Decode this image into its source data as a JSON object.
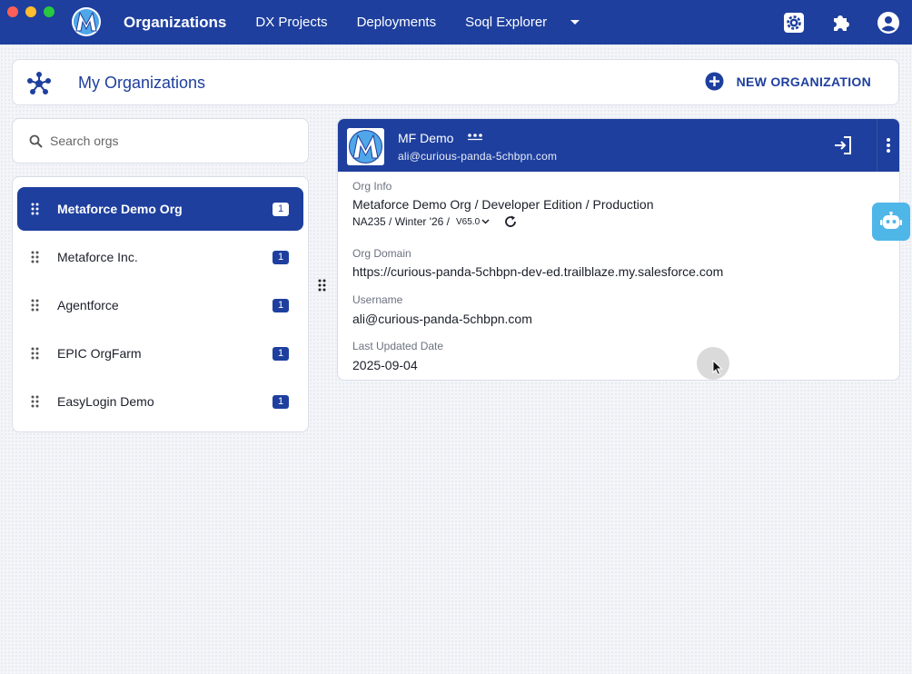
{
  "window": {
    "traffic_colors": [
      "#fe5f57",
      "#febc2e",
      "#28c840"
    ]
  },
  "nav": {
    "items": [
      {
        "label": "Organizations",
        "active": true
      },
      {
        "label": "DX Projects",
        "active": false
      },
      {
        "label": "Deployments",
        "active": false
      },
      {
        "label": "Soql Explorer",
        "active": false
      }
    ],
    "more_icon": "caret-down-icon",
    "right_icons": [
      "settings-icon",
      "extensions-icon",
      "account-icon"
    ]
  },
  "header": {
    "icon": "hub-icon",
    "title": "My Organizations",
    "new_org_label": "NEW ORGANIZATION"
  },
  "search": {
    "placeholder": "Search orgs",
    "value": ""
  },
  "orgs": [
    {
      "name": "Metaforce Demo Org",
      "count": "1",
      "selected": true
    },
    {
      "name": "Metaforce Inc.",
      "count": "1",
      "selected": false
    },
    {
      "name": "Agentforce",
      "count": "1",
      "selected": false
    },
    {
      "name": "EPIC OrgFarm",
      "count": "1",
      "selected": false
    },
    {
      "name": "EasyLogin Demo",
      "count": "1",
      "selected": false
    }
  ],
  "detail": {
    "alias": "MF Demo",
    "username_header": "ali@curious-panda-5chbpn.com",
    "org_info_label": "Org Info",
    "org_info_value": "Metaforce Demo Org / Developer Edition / Production",
    "instance_release": "NA235 / Winter '26 /",
    "api_version": "V65.0",
    "domain_label": "Org Domain",
    "domain_value": "https://curious-panda-5chbpn-dev-ed.trailblaze.my.salesforce.com",
    "username_label": "Username",
    "username_value": "ali@curious-panda-5chbpn.com",
    "updated_label": "Last Updated Date",
    "updated_value": "2025-09-04"
  },
  "colors": {
    "brand": "#1e3f9e",
    "assistant": "#4fb6e8"
  }
}
